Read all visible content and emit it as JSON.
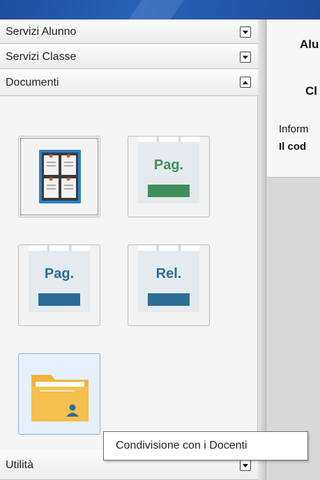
{
  "sidebar": {
    "sections": [
      {
        "label": "Servizi Alunno",
        "state": "collapsed"
      },
      {
        "label": "Servizi Classe",
        "state": "collapsed"
      },
      {
        "label": "Documenti",
        "state": "expanded"
      }
    ],
    "documenti_tiles": [
      {
        "icon": "bulletin-board-icon"
      },
      {
        "icon": "document-page-green-icon",
        "label": "Pag."
      },
      {
        "icon": "document-page-blue-icon",
        "label": "Pag."
      },
      {
        "icon": "document-report-icon",
        "label": "Rel."
      },
      {
        "icon": "shared-folder-user-icon"
      }
    ],
    "bottom_section": {
      "label": "Utilità",
      "state": "collapsed"
    }
  },
  "tooltip": {
    "text": "Condivisione con i Docenti"
  },
  "right_panel": {
    "line1": "Alu",
    "line2": "Cl",
    "line3": "Inform",
    "line4": "Il cod"
  },
  "colors": {
    "accent_blue": "#2c6d93",
    "accent_green": "#3f8f5b",
    "folder_yellow": "#f6c04e"
  }
}
